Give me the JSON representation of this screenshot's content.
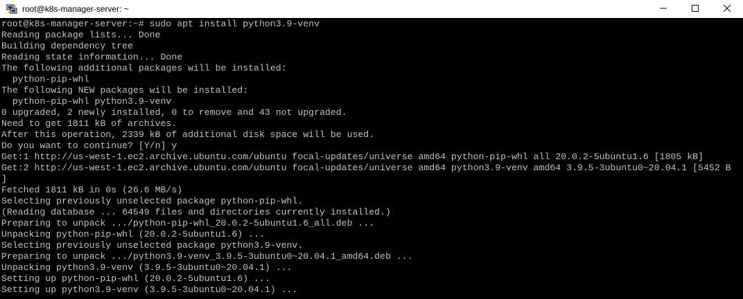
{
  "window": {
    "title": "root@k8s-manager-server: ~"
  },
  "titlebar_icons": {
    "app": "putty-icon",
    "minimize": "minimize-icon",
    "maximize": "maximize-icon",
    "close": "close-icon"
  },
  "colors": {
    "terminal_background": "#000000",
    "terminal_foreground": "#c0c0c0",
    "titlebar_background": "#ffffff"
  },
  "terminal": {
    "lines": [
      "root@k8s-manager-server:~# sudo apt install python3.9-venv",
      "Reading package lists... Done",
      "Building dependency tree",
      "Reading state information... Done",
      "The following additional packages will be installed:",
      "  python-pip-whl",
      "The following NEW packages will be installed:",
      "  python-pip-whl python3.9-venv",
      "0 upgraded, 2 newly installed, 0 to remove and 43 not upgraded.",
      "Need to get 1811 kB of archives.",
      "After this operation, 2339 kB of additional disk space will be used.",
      "Do you want to continue? [Y/n] y",
      "Get:1 http://us-west-1.ec2.archive.ubuntu.com/ubuntu focal-updates/universe amd64 python-pip-whl all 20.0.2-5ubuntu1.6 [1805 kB]",
      "Get:2 http://us-west-1.ec2.archive.ubuntu.com/ubuntu focal-updates/universe amd64 python3.9-venv amd64 3.9.5-3ubuntu0~20.04.1 [5452 B",
      "]",
      "Fetched 1811 kB in 0s (26.6 MB/s)",
      "Selecting previously unselected package python-pip-whl.",
      "(Reading database ... 64549 files and directories currently installed.)",
      "Preparing to unpack .../python-pip-whl_20.0.2-5ubuntu1.6_all.deb ...",
      "Unpacking python-pip-whl (20.0.2-5ubuntu1.6) ...",
      "Selecting previously unselected package python3.9-venv.",
      "Preparing to unpack .../python3.9-venv_3.9.5-3ubuntu0~20.04.1_amd64.deb ...",
      "Unpacking python3.9-venv (3.9.5-3ubuntu0~20.04.1) ...",
      "Setting up python-pip-whl (20.0.2-5ubuntu1.6) ...",
      "Setting up python3.9-venv (3.9.5-3ubuntu0~20.04.1) ..."
    ]
  }
}
